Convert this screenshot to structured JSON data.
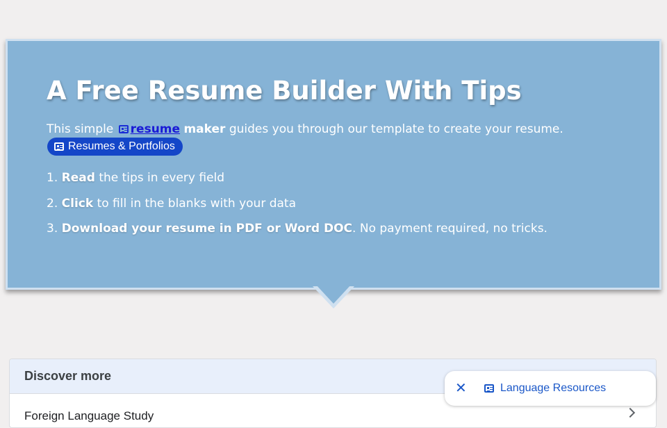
{
  "hero": {
    "title": "A Free Resume Builder With Tips",
    "intro_prefix": "This simple",
    "intro_link": "resume",
    "intro_bold": "maker",
    "intro_suffix": "guides you through our template to create your resume.",
    "pill_label": "Resumes & Portfolios",
    "steps": [
      {
        "num": "1.",
        "bold": "Read",
        "rest": "the tips in every field"
      },
      {
        "num": "2.",
        "bold": "Click",
        "rest": "to fill in the blanks with your data"
      },
      {
        "num": "3.",
        "bold": "Download your resume in PDF or Word DOC",
        "rest": ". No payment required, no tricks."
      }
    ]
  },
  "discover": {
    "header": "Discover more",
    "items": [
      "Foreign Language Study"
    ]
  },
  "chip": {
    "close_symbol": "✕",
    "label": "Language Resources"
  },
  "colors": {
    "hero_bg": "#86b3d6",
    "link": "#1a1ad6",
    "pill_bg": "#1446c8",
    "chip_text": "#1a57c8"
  },
  "icons": [
    "newspaper-icon",
    "close-icon",
    "chevron-right-icon"
  ]
}
